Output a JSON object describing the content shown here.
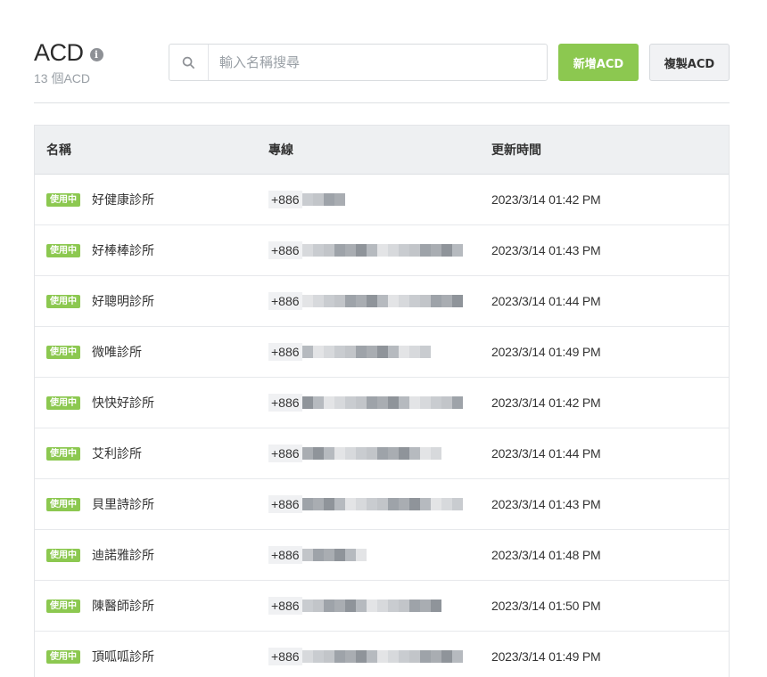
{
  "header": {
    "title": "ACD",
    "count": "13 個ACD",
    "info_icon": "info-icon"
  },
  "search": {
    "placeholder": "輸入名稱搜尋",
    "icon": "search-icon"
  },
  "actions": {
    "add_label": "新增ACD",
    "copy_label": "複製ACD"
  },
  "colors": {
    "accent": "#8cc850",
    "header_bg": "#eef0f2"
  },
  "table": {
    "columns": [
      "名稱",
      "專線",
      "更新時間"
    ],
    "rows": [
      {
        "status": "使用中",
        "name": "好健康診所",
        "line": "+886",
        "updated": "2023/3/14 01:42 PM"
      },
      {
        "status": "使用中",
        "name": "好棒棒診所",
        "line": "+886",
        "updated": "2023/3/14 01:43 PM"
      },
      {
        "status": "使用中",
        "name": "好聰明診所",
        "line": "+886",
        "updated": "2023/3/14 01:44 PM"
      },
      {
        "status": "使用中",
        "name": "微唯診所",
        "line": "+886",
        "updated": "2023/3/14 01:49 PM"
      },
      {
        "status": "使用中",
        "name": "快快好診所",
        "line": "+886",
        "updated": "2023/3/14 01:42 PM"
      },
      {
        "status": "使用中",
        "name": "艾利診所",
        "line": "+886",
        "updated": "2023/3/14 01:44 PM"
      },
      {
        "status": "使用中",
        "name": "貝里詩診所",
        "line": "+886",
        "updated": "2023/3/14 01:43 PM"
      },
      {
        "status": "使用中",
        "name": "迪諾雅診所",
        "line": "+886",
        "updated": "2023/3/14 01:48 PM"
      },
      {
        "status": "使用中",
        "name": "陳醫師診所",
        "line": "+886",
        "updated": "2023/3/14 01:50 PM"
      },
      {
        "status": "使用中",
        "name": "頂呱呱診所",
        "line": "+886",
        "updated": "2023/3/14 01:49 PM"
      }
    ]
  }
}
